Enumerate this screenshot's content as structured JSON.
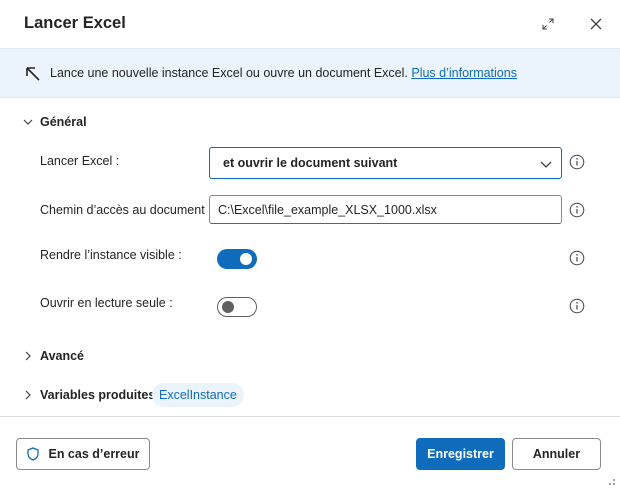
{
  "dialog": {
    "title": "Lancer Excel",
    "expand_icon": "expand-icon",
    "close_icon": "close-icon"
  },
  "banner": {
    "icon": "arrow-up-left-icon",
    "text": "Lance une nouvelle instance Excel ou ouvre un document Excel.",
    "link": "Plus d’informations"
  },
  "sections": {
    "general": "Général",
    "advanced": "Avancé",
    "variables": "Variables produites"
  },
  "fields": {
    "launch": {
      "label": "Lancer Excel :",
      "value": "et ouvrir le document suivant"
    },
    "path": {
      "label": "Chemin d’accès au document :",
      "value": "C:\\Excel\\file_example_XLSX_1000.xlsx"
    },
    "visible": {
      "label": "Rendre l’instance visible :",
      "state": true
    },
    "readonly": {
      "label": "Ouvrir en lecture seule :",
      "state": false
    }
  },
  "variables": {
    "chip": "ExcelInstance"
  },
  "footer": {
    "error_button": "En cas d’erreur",
    "save_button": "Enregistrer",
    "cancel_button": "Annuler"
  },
  "colors": {
    "accent": "#0f6cbd",
    "banner_bg": "#ebf3fc"
  }
}
